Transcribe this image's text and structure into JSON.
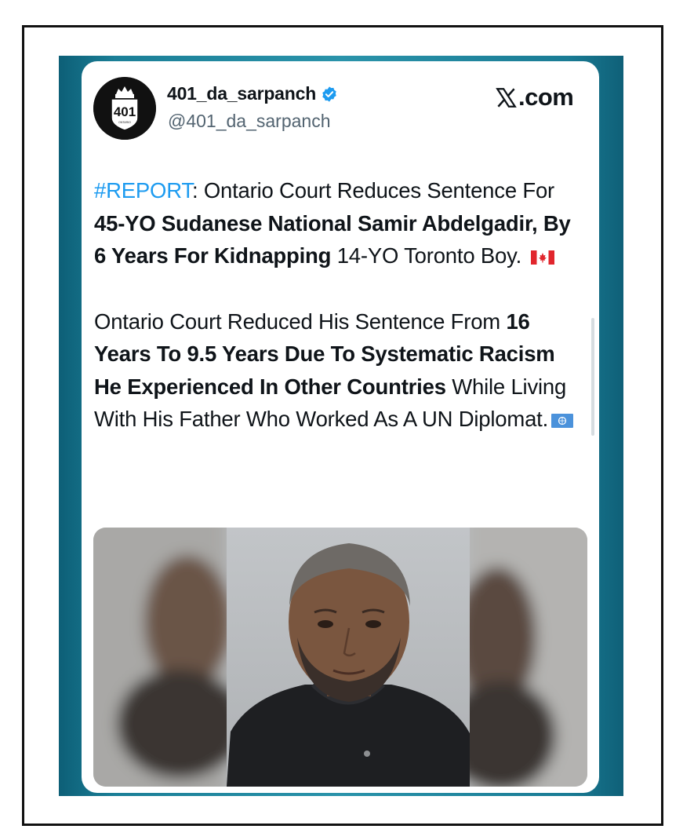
{
  "post": {
    "author": {
      "display_name": "401_da_sarpanch",
      "handle": "@401_da_sarpanch",
      "verified": true,
      "avatar": {
        "number": "401",
        "subtext": "ONTARIO"
      }
    },
    "site": {
      "name": "X.com",
      "suffix": ".com"
    },
    "paragraph1": {
      "hashtag": "#REPORT",
      "t1": ": Ontario Court Reduces Sentence For ",
      "b1": "45-YO Sudanese National Samir Abdelgadir, By 6 Years For Kidnapping",
      "t2": " 14-YO Toronto Boy. ",
      "flag": "canada-flag"
    },
    "paragraph2": {
      "t1": "Ontario Court Reduced His Sentence From ",
      "b1": "16 Years To 9.5 Years Due To Systematic Racism He Experienced In Other Countries",
      "t2": " While Living With His Father Who Worked As A UN Diplomat.",
      "flag": "un-flag"
    },
    "media": {
      "type": "photo"
    }
  },
  "colors": {
    "backdrop": "#1b7f97",
    "link": "#1d9bf0",
    "verified": "#1d9bf0",
    "text": "#0f1419",
    "secondary": "#536471"
  }
}
